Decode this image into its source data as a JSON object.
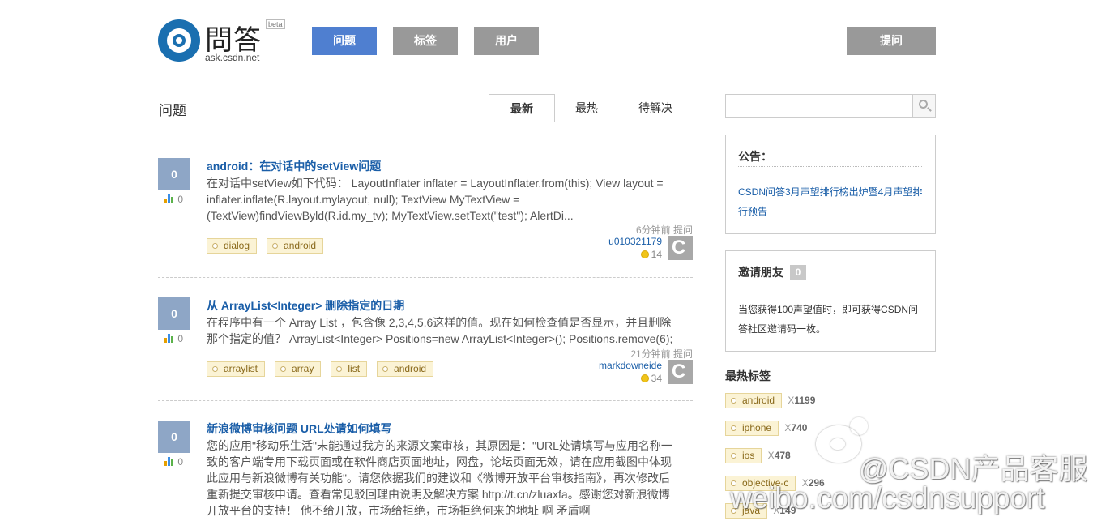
{
  "logo": {
    "text": "問答",
    "beta": "beta",
    "domain": "ask.csdn.net"
  },
  "nav": {
    "questions": "问题",
    "tags": "标签",
    "users": "用户",
    "ask": "提问"
  },
  "main": {
    "title": "问题",
    "tabs": [
      "最新",
      "最热",
      "待解决"
    ]
  },
  "questions": [
    {
      "votes": "0",
      "views": "0",
      "title": "android：在对话中的setView问题",
      "excerpt": "在对话中setView如下代码： LayoutInflater inflater = LayoutInflater.from(this); View layout = inflater.inflate(R.layout.mylayout, null); TextView MyTextView = (TextView)findViewByld(R.id.my_tv); MyTextView.setText(\"test\"); AlertDi...",
      "time": "6分钟前 提问",
      "user": "u010321179",
      "reputation": "14",
      "tags": [
        "dialog",
        "android"
      ]
    },
    {
      "votes": "0",
      "views": "0",
      "title": "从 ArrayList<Integer> 删除指定的日期",
      "excerpt": "在程序中有一个 Array List ，包含像 2,3,4,5,6这样的值。现在如何检查值是否显示，并且删除那个指定的值？ ArrayList<Integer> Positions=new ArrayList<Integer>(); Positions.remove(6);",
      "time": "21分钟前 提问",
      "user": "markdowneide",
      "reputation": "34",
      "tags": [
        "arraylist",
        "array",
        "list",
        "android"
      ]
    },
    {
      "votes": "0",
      "views": "0",
      "title": "新浪微博审核问题 URL处请如何填写",
      "excerpt": "您的应用\"移动乐生活\"未能通过我方的来源文案审核，其原因是：\"URL处请填写与应用名称一致的客户端专用下载页面或在软件商店页面地址，网盘，论坛页面无效，请在应用截图中体现此应用与新浪微博有关功能\"。请您依据我们的建议和《微博开放平台审核指南》，再次修改后重新提交审核申请。查看常见驳回理由说明及解决方案 http://t.cn/zluaxfa。感谢您对新浪微博开放平台的支持！ 他不给开放，市场给拒绝，市场拒绝何来的地址 啊 矛盾啊"
    }
  ],
  "sidebar": {
    "search_placeholder": "",
    "notice": {
      "title": "公告：",
      "link": "CSDN问答3月声望排行榜出炉暨4月声望排行预告"
    },
    "invite": {
      "title": "邀请朋友",
      "count": "0",
      "text": "当您获得100声望值时，即可获得CSDN问答社区邀请码一枚。"
    },
    "hot_tags": {
      "title": "最热标签",
      "items": [
        {
          "name": "android",
          "count": "1199"
        },
        {
          "name": "iphone",
          "count": "740"
        },
        {
          "name": "ios",
          "count": "478"
        },
        {
          "name": "objective-c",
          "count": "296"
        },
        {
          "name": "java",
          "count": "149"
        }
      ]
    }
  },
  "watermark": {
    "line1": "@CSDN产品客服",
    "line2": "weibo.com/csdnsupport"
  },
  "colors": {
    "nav_active": "#4f7fd0",
    "nav_inactive": "#999999",
    "link": "#1a5ea8",
    "vote_box": "#8ea6c6"
  },
  "icons": [
    "search-icon",
    "stats-icon",
    "coin-icon",
    "weibo-icon"
  ]
}
